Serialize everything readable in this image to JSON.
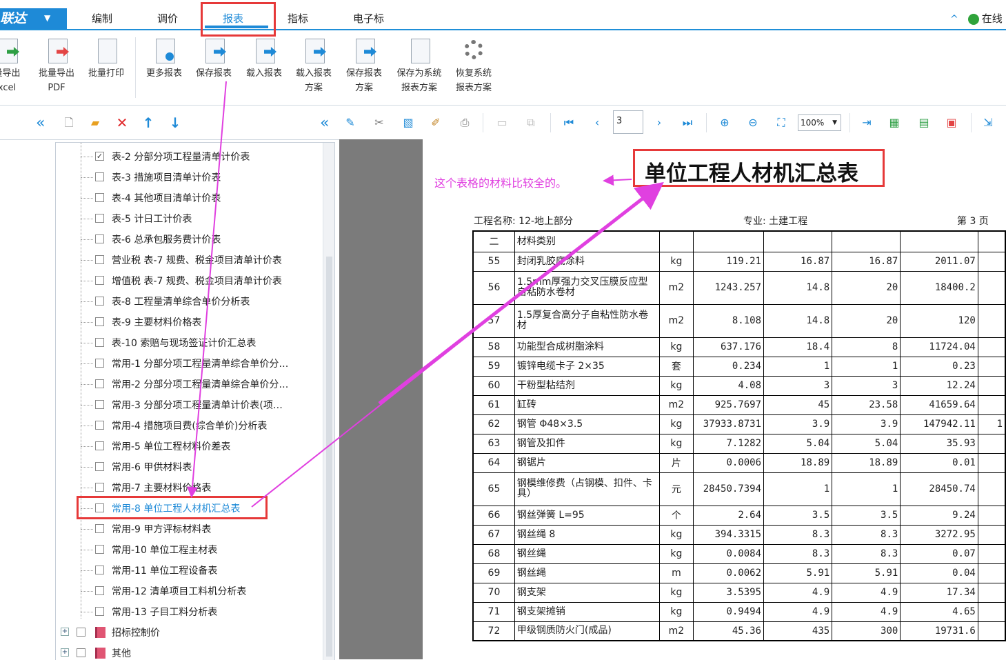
{
  "menu": {
    "brand": "联达",
    "tabs": [
      "编制",
      "调价",
      "报表",
      "指标",
      "电子标"
    ],
    "online": "在线"
  },
  "ribbon": {
    "buttons": [
      {
        "l1": "量导出",
        "l2": "xcel"
      },
      {
        "l1": "批量导出",
        "l2": "PDF"
      },
      {
        "l1": "批量打印",
        "l2": ""
      },
      {
        "l1": "更多报表",
        "l2": ""
      },
      {
        "l1": "保存报表",
        "l2": ""
      },
      {
        "l1": "载入报表",
        "l2": ""
      },
      {
        "l1": "载入报表",
        "l2": "方案"
      },
      {
        "l1": "保存报表",
        "l2": "方案"
      },
      {
        "l1": "保存为系统",
        "l2": "报表方案"
      },
      {
        "l1": "恢复系统",
        "l2": "报表方案"
      }
    ]
  },
  "toolbar": {
    "page": "3",
    "zoom": "100%"
  },
  "tree": {
    "items": [
      {
        "label": "表-2 分部分项工程量清单计价表",
        "checked": "✓"
      },
      {
        "label": "表-3 措施项目清单计价表",
        "checked": ""
      },
      {
        "label": "表-4 其他项目清单计价表",
        "checked": ""
      },
      {
        "label": "表-5 计日工计价表",
        "checked": ""
      },
      {
        "label": "表-6 总承包服务费计价表",
        "checked": ""
      },
      {
        "label": "营业税 表-7 规费、税金项目清单计价表",
        "checked": ""
      },
      {
        "label": "增值税 表-7 规费、税金项目清单计价表",
        "checked": ""
      },
      {
        "label": "表-8 工程量清单综合单价分析表",
        "checked": ""
      },
      {
        "label": "表-9 主要材料价格表",
        "checked": ""
      },
      {
        "label": "表-10 索赔与现场签证计价汇总表",
        "checked": ""
      },
      {
        "label": "常用-1 分部分项工程量清单综合单价分…",
        "checked": ""
      },
      {
        "label": "常用-2 分部分项工程量清单综合单价分…",
        "checked": ""
      },
      {
        "label": "常用-3 分部分项工程量清单计价表(项…",
        "checked": ""
      },
      {
        "label": "常用-4 措施项目费(综合单价)分析表",
        "checked": ""
      },
      {
        "label": "常用-5 单位工程材料价差表",
        "checked": ""
      },
      {
        "label": "常用-6 甲供材料表",
        "checked": ""
      },
      {
        "label": "常用-7 主要材料价格表",
        "checked": ""
      },
      {
        "label": "常用-8 单位工程人材机汇总表",
        "checked": ""
      },
      {
        "label": "常用-9 甲方评标材料表",
        "checked": ""
      },
      {
        "label": "常用-10 单位工程主材表",
        "checked": ""
      },
      {
        "label": "常用-11 单位工程设备表",
        "checked": ""
      },
      {
        "label": "常用-12 清单项目工料机分析表",
        "checked": ""
      },
      {
        "label": "常用-13 子目工料分析表",
        "checked": ""
      }
    ],
    "groups": [
      "招标控制价",
      "其他"
    ]
  },
  "report": {
    "title": "单位工程人材机汇总表",
    "annotation": "这个表格的材料比较全的。",
    "project": "工程名称: 12-地上部分",
    "major": "专业: 土建工程",
    "page": "第 3 页",
    "rows": [
      {
        "n": "二",
        "name": "材料类别",
        "u": "",
        "q": "",
        "p1": "",
        "p2": "",
        "t": "",
        "x": ""
      },
      {
        "n": "55",
        "name": "封闭乳胶底涂料",
        "u": "kg",
        "q": "119.21",
        "p1": "16.87",
        "p2": "16.87",
        "t": "2011.07",
        "x": ""
      },
      {
        "n": "56",
        "name": "1.5mm厚强力交叉压膜反应型自粘防水卷材",
        "u": "m2",
        "q": "1243.257",
        "p1": "14.8",
        "p2": "20",
        "t": "18400.2",
        "x": ""
      },
      {
        "n": "57",
        "name": "1.5厚复合高分子自粘性防水卷材",
        "u": "m2",
        "q": "8.108",
        "p1": "14.8",
        "p2": "20",
        "t": "120",
        "x": ""
      },
      {
        "n": "58",
        "name": "功能型合成树脂涂料",
        "u": "kg",
        "q": "637.176",
        "p1": "18.4",
        "p2": "8",
        "t": "11724.04",
        "x": ""
      },
      {
        "n": "59",
        "name": "镀锌电缆卡子 2×35",
        "u": "套",
        "q": "0.234",
        "p1": "1",
        "p2": "1",
        "t": "0.23",
        "x": ""
      },
      {
        "n": "60",
        "name": "干粉型粘结剂",
        "u": "kg",
        "q": "4.08",
        "p1": "3",
        "p2": "3",
        "t": "12.24",
        "x": ""
      },
      {
        "n": "61",
        "name": "缸砖",
        "u": "m2",
        "q": "925.7697",
        "p1": "45",
        "p2": "23.58",
        "t": "41659.64",
        "x": ""
      },
      {
        "n": "62",
        "name": "钢管 Φ48×3.5",
        "u": "kg",
        "q": "37933.8731",
        "p1": "3.9",
        "p2": "3.9",
        "t": "147942.11",
        "x": "1"
      },
      {
        "n": "63",
        "name": "钢管及扣件",
        "u": "kg",
        "q": "7.1282",
        "p1": "5.04",
        "p2": "5.04",
        "t": "35.93",
        "x": ""
      },
      {
        "n": "64",
        "name": "钢锯片",
        "u": "片",
        "q": "0.0006",
        "p1": "18.89",
        "p2": "18.89",
        "t": "0.01",
        "x": ""
      },
      {
        "n": "65",
        "name": "钢模维修费（占钢模、扣件、卡具）",
        "u": "元",
        "q": "28450.7394",
        "p1": "1",
        "p2": "1",
        "t": "28450.74",
        "x": ""
      },
      {
        "n": "66",
        "name": "钢丝弹簧 L=95",
        "u": "个",
        "q": "2.64",
        "p1": "3.5",
        "p2": "3.5",
        "t": "9.24",
        "x": ""
      },
      {
        "n": "67",
        "name": "钢丝绳 8",
        "u": "kg",
        "q": "394.3315",
        "p1": "8.3",
        "p2": "8.3",
        "t": "3272.95",
        "x": ""
      },
      {
        "n": "68",
        "name": "钢丝绳",
        "u": "kg",
        "q": "0.0084",
        "p1": "8.3",
        "p2": "8.3",
        "t": "0.07",
        "x": ""
      },
      {
        "n": "69",
        "name": "钢丝绳",
        "u": "m",
        "q": "0.0062",
        "p1": "5.91",
        "p2": "5.91",
        "t": "0.04",
        "x": ""
      },
      {
        "n": "70",
        "name": "钢支架",
        "u": "kg",
        "q": "3.5395",
        "p1": "4.9",
        "p2": "4.9",
        "t": "17.34",
        "x": ""
      },
      {
        "n": "71",
        "name": "钢支架摊销",
        "u": "kg",
        "q": "0.9494",
        "p1": "4.9",
        "p2": "4.9",
        "t": "4.65",
        "x": ""
      },
      {
        "n": "72",
        "name": "甲级钢质防火门(成品)",
        "u": "m2",
        "q": "45.36",
        "p1": "435",
        "p2": "300",
        "t": "19731.6",
        "x": ""
      }
    ]
  },
  "colors": {
    "accent": "#1e8ad7",
    "annotation": "#e040e0",
    "highlight": "#e63939"
  }
}
